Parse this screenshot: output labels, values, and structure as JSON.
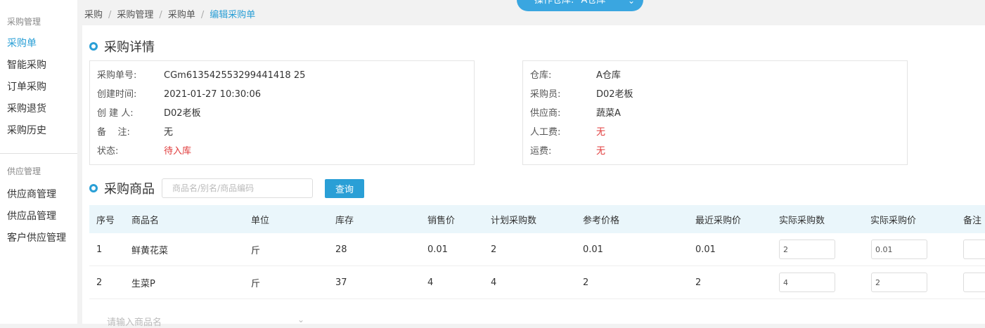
{
  "sidebar": {
    "group1_title": "采购管理",
    "group1_items": [
      "采购单",
      "智能采购",
      "订单采购",
      "采购退货",
      "采购历史"
    ],
    "group2_title": "供应管理",
    "group2_items": [
      "供应商管理",
      "供应品管理",
      "客户供应管理"
    ]
  },
  "breadcrumb": {
    "items": [
      "采购",
      "采购管理",
      "采购单"
    ],
    "current": "编辑采购单",
    "separator": "/"
  },
  "warehouse_selector": {
    "label": "操作仓库:",
    "value": "A仓库"
  },
  "detail": {
    "title": "采购详情",
    "left": [
      {
        "label": "采购单号:",
        "value": "CGm613542553299441418 25",
        "status": false
      },
      {
        "label": "创建时间:",
        "value": "2021-01-27 10:30:06",
        "status": false
      },
      {
        "label": "创 建 人:",
        "value": "D02老板",
        "status": false
      },
      {
        "label": "备    注:",
        "value": "无",
        "status": false
      },
      {
        "label": "状态:",
        "value": "待入库",
        "status": true
      }
    ],
    "right": [
      {
        "label": "仓库:",
        "value": "A仓库",
        "status": false
      },
      {
        "label": "采购员:",
        "value": "D02老板",
        "status": false
      },
      {
        "label": "供应商:",
        "value": "蔬菜A",
        "status": false
      },
      {
        "label": "人工费:",
        "value": "无",
        "status": true
      },
      {
        "label": "运费:",
        "value": "无",
        "status": true
      }
    ]
  },
  "goods": {
    "title": "采购商品",
    "search_placeholder": "商品名/别名/商品编码",
    "query_label": "查询",
    "columns": [
      "序号",
      "商品名",
      "单位",
      "库存",
      "销售价",
      "计划采购数",
      "参考价格",
      "最近采购价",
      "实际采购数",
      "实际采购价",
      "备注"
    ],
    "rows": [
      {
        "no": "1",
        "name": "鲜黄花菜",
        "unit": "斤",
        "stock": "28",
        "sale_price": "0.01",
        "planned_qty": "2",
        "ref_price": "0.01",
        "last_price": "0.01",
        "actual_qty": "2",
        "actual_price": "0.01",
        "remark": ""
      },
      {
        "no": "2",
        "name": "生菜P",
        "unit": "斤",
        "stock": "37",
        "sale_price": "4",
        "planned_qty": "4",
        "ref_price": "2",
        "last_price": "2",
        "actual_qty": "4",
        "actual_price": "2",
        "remark": ""
      }
    ],
    "add_placeholder": "请输入商品名"
  },
  "colors": {
    "accent": "#2a9fd6",
    "status_red": "#e03a3a",
    "table_header_bg": "#eaf6fb"
  }
}
